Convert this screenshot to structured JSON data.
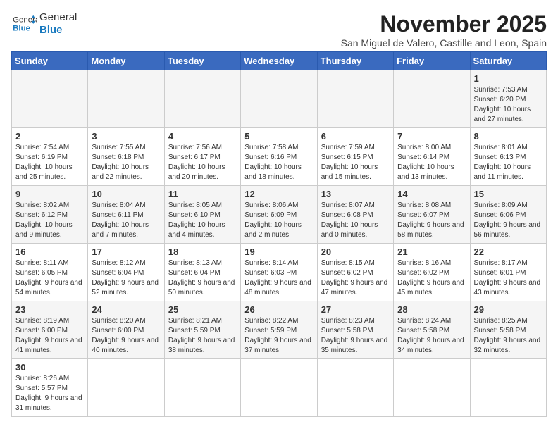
{
  "logo": {
    "text_general": "General",
    "text_blue": "Blue"
  },
  "header": {
    "month_year": "November 2025",
    "location": "San Miguel de Valero, Castille and Leon, Spain"
  },
  "weekdays": [
    "Sunday",
    "Monday",
    "Tuesday",
    "Wednesday",
    "Thursday",
    "Friday",
    "Saturday"
  ],
  "weeks": [
    [
      null,
      null,
      null,
      null,
      null,
      null,
      {
        "day": "1",
        "sunrise": "7:53 AM",
        "sunset": "6:20 PM",
        "daylight": "10 hours and 27 minutes."
      }
    ],
    [
      {
        "day": "2",
        "sunrise": "7:54 AM",
        "sunset": "6:19 PM",
        "daylight": "10 hours and 25 minutes."
      },
      {
        "day": "3",
        "sunrise": "7:55 AM",
        "sunset": "6:18 PM",
        "daylight": "10 hours and 22 minutes."
      },
      {
        "day": "4",
        "sunrise": "7:56 AM",
        "sunset": "6:17 PM",
        "daylight": "10 hours and 20 minutes."
      },
      {
        "day": "5",
        "sunrise": "7:58 AM",
        "sunset": "6:16 PM",
        "daylight": "10 hours and 18 minutes."
      },
      {
        "day": "6",
        "sunrise": "7:59 AM",
        "sunset": "6:15 PM",
        "daylight": "10 hours and 15 minutes."
      },
      {
        "day": "7",
        "sunrise": "8:00 AM",
        "sunset": "6:14 PM",
        "daylight": "10 hours and 13 minutes."
      },
      {
        "day": "8",
        "sunrise": "8:01 AM",
        "sunset": "6:13 PM",
        "daylight": "10 hours and 11 minutes."
      }
    ],
    [
      {
        "day": "9",
        "sunrise": "8:02 AM",
        "sunset": "6:12 PM",
        "daylight": "10 hours and 9 minutes."
      },
      {
        "day": "10",
        "sunrise": "8:04 AM",
        "sunset": "6:11 PM",
        "daylight": "10 hours and 7 minutes."
      },
      {
        "day": "11",
        "sunrise": "8:05 AM",
        "sunset": "6:10 PM",
        "daylight": "10 hours and 4 minutes."
      },
      {
        "day": "12",
        "sunrise": "8:06 AM",
        "sunset": "6:09 PM",
        "daylight": "10 hours and 2 minutes."
      },
      {
        "day": "13",
        "sunrise": "8:07 AM",
        "sunset": "6:08 PM",
        "daylight": "10 hours and 0 minutes."
      },
      {
        "day": "14",
        "sunrise": "8:08 AM",
        "sunset": "6:07 PM",
        "daylight": "9 hours and 58 minutes."
      },
      {
        "day": "15",
        "sunrise": "8:09 AM",
        "sunset": "6:06 PM",
        "daylight": "9 hours and 56 minutes."
      }
    ],
    [
      {
        "day": "16",
        "sunrise": "8:11 AM",
        "sunset": "6:05 PM",
        "daylight": "9 hours and 54 minutes."
      },
      {
        "day": "17",
        "sunrise": "8:12 AM",
        "sunset": "6:04 PM",
        "daylight": "9 hours and 52 minutes."
      },
      {
        "day": "18",
        "sunrise": "8:13 AM",
        "sunset": "6:04 PM",
        "daylight": "9 hours and 50 minutes."
      },
      {
        "day": "19",
        "sunrise": "8:14 AM",
        "sunset": "6:03 PM",
        "daylight": "9 hours and 48 minutes."
      },
      {
        "day": "20",
        "sunrise": "8:15 AM",
        "sunset": "6:02 PM",
        "daylight": "9 hours and 47 minutes."
      },
      {
        "day": "21",
        "sunrise": "8:16 AM",
        "sunset": "6:02 PM",
        "daylight": "9 hours and 45 minutes."
      },
      {
        "day": "22",
        "sunrise": "8:17 AM",
        "sunset": "6:01 PM",
        "daylight": "9 hours and 43 minutes."
      }
    ],
    [
      {
        "day": "23",
        "sunrise": "8:19 AM",
        "sunset": "6:00 PM",
        "daylight": "9 hours and 41 minutes."
      },
      {
        "day": "24",
        "sunrise": "8:20 AM",
        "sunset": "6:00 PM",
        "daylight": "9 hours and 40 minutes."
      },
      {
        "day": "25",
        "sunrise": "8:21 AM",
        "sunset": "5:59 PM",
        "daylight": "9 hours and 38 minutes."
      },
      {
        "day": "26",
        "sunrise": "8:22 AM",
        "sunset": "5:59 PM",
        "daylight": "9 hours and 37 minutes."
      },
      {
        "day": "27",
        "sunrise": "8:23 AM",
        "sunset": "5:58 PM",
        "daylight": "9 hours and 35 minutes."
      },
      {
        "day": "28",
        "sunrise": "8:24 AM",
        "sunset": "5:58 PM",
        "daylight": "9 hours and 34 minutes."
      },
      {
        "day": "29",
        "sunrise": "8:25 AM",
        "sunset": "5:58 PM",
        "daylight": "9 hours and 32 minutes."
      }
    ],
    [
      {
        "day": "30",
        "sunrise": "8:26 AM",
        "sunset": "5:57 PM",
        "daylight": "9 hours and 31 minutes."
      },
      null,
      null,
      null,
      null,
      null,
      null
    ]
  ]
}
